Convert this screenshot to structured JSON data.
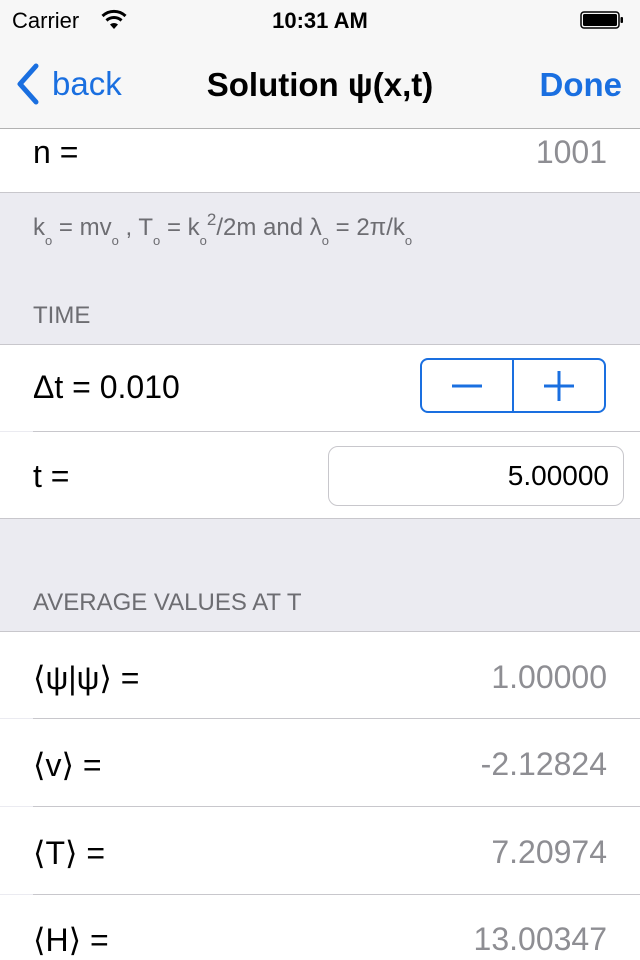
{
  "status_bar": {
    "carrier": "Carrier",
    "time": "10:31 AM",
    "wifi_icon": "wifi-icon",
    "battery_icon": "battery-full-icon"
  },
  "nav": {
    "back_label": "back",
    "title": "Solution ψ(x,t)",
    "done_label": "Done",
    "accent_color": "#1a6fe0"
  },
  "parameters": {
    "n_label": "n =",
    "n_value": "1001",
    "footer_note": {
      "k0": "k",
      "eq1": " = mv",
      "sep1": " ,  T",
      "eq2": " = k",
      "sq": "2",
      "eq2b": "/2m  and  λ",
      "eq3": " = 2π/k",
      "sub": "o"
    }
  },
  "time_section": {
    "header": "TIME",
    "dt_label": "Δt = 0.010",
    "stepper": {
      "minus_icon": "minus-icon",
      "plus_icon": "plus-icon"
    },
    "t_label": "t =",
    "t_value": "5.00000"
  },
  "averages_section": {
    "header": "AVERAGE VALUES AT T",
    "rows": [
      {
        "label": "⟨ψ|ψ⟩ =",
        "value": "1.00000"
      },
      {
        "label": "⟨v⟩ =",
        "value": "-2.12824"
      },
      {
        "label": "⟨T⟩ =",
        "value": "7.20974"
      },
      {
        "label": "⟨H⟩ =",
        "value": "13.00347"
      }
    ]
  }
}
